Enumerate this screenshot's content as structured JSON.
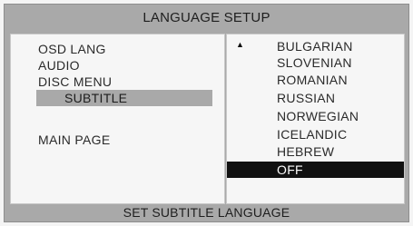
{
  "header": {
    "title": "LANGUAGE SETUP"
  },
  "menu": {
    "items": [
      {
        "label": "OSD LANG"
      },
      {
        "label": "AUDIO"
      },
      {
        "label": "DISC MENU"
      },
      {
        "label": "SUBTITLE",
        "selected": true
      },
      {
        "label": "MAIN PAGE"
      }
    ]
  },
  "options": {
    "scroll_up_icon": "triangle-up",
    "items": [
      {
        "label": "BULGARIAN"
      },
      {
        "label": "SLOVENIAN"
      },
      {
        "label": "ROMANIAN"
      },
      {
        "label": "RUSSIAN"
      },
      {
        "label": "NORWEGIAN"
      },
      {
        "label": "ICELANDIC"
      },
      {
        "label": "HEBREW"
      },
      {
        "label": "OFF",
        "selected": true
      }
    ]
  },
  "footer": {
    "hint": "SET SUBTITLE LANGUAGE"
  },
  "colors": {
    "frame": "#a9a9a9",
    "panel": "#f6f6f6",
    "highlight_menu": "#a9a9a9",
    "highlight_option": "#111111"
  }
}
